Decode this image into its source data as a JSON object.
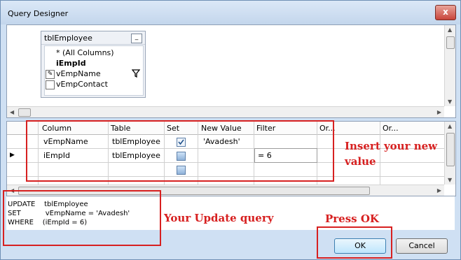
{
  "window": {
    "title": "Query Designer",
    "close_glyph": "x"
  },
  "diagram": {
    "table_name": "tblEmployee",
    "minimize_glyph": "_",
    "columns": [
      {
        "label": "* (All Columns)",
        "checked": false
      },
      {
        "label": "iEmpId",
        "checked": false
      },
      {
        "label": "vEmpName",
        "checked": true
      },
      {
        "label": "vEmpContact",
        "checked": false
      }
    ],
    "filter_icon": "funnel-icon"
  },
  "grid": {
    "headers": [
      "Column",
      "Table",
      "Set",
      "New Value",
      "Filter",
      "Or...",
      "Or..."
    ],
    "rows": [
      {
        "column": "vEmpName",
        "table": "tblEmployee",
        "set": true,
        "new_value": "'Avadesh'",
        "filter": ""
      },
      {
        "column": "iEmpId",
        "table": "tblEmployee",
        "set": false,
        "new_value": "",
        "filter": "= 6"
      }
    ],
    "row_marker": "▶"
  },
  "sql": {
    "lines": [
      "UPDATE    tblEmployee",
      "SET           vEmpName = 'Avadesh'",
      "WHERE    (iEmpId = 6)"
    ]
  },
  "buttons": {
    "ok": "OK",
    "cancel": "Cancel"
  },
  "annotations": {
    "insert_value": "Insert your new value",
    "update_query": "Your Update query",
    "press_ok": "Press OK"
  },
  "colors": {
    "annotation": "#d72020"
  }
}
